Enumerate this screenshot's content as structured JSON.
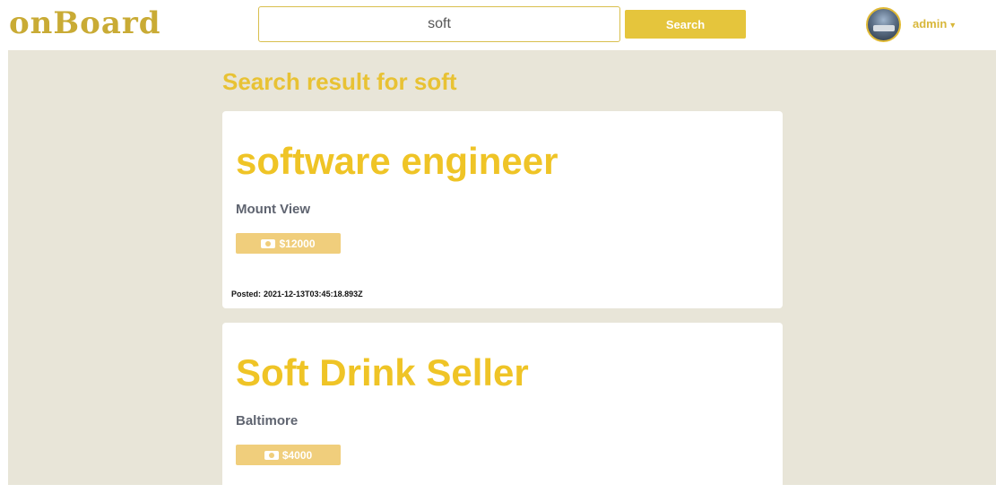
{
  "header": {
    "logo_text": "onBoard",
    "search": {
      "value": "soft",
      "placeholder": ""
    },
    "search_button_label": "Search",
    "user": {
      "name": "admin"
    }
  },
  "results": {
    "heading": "Search result for soft",
    "jobs": [
      {
        "title": "software engineer",
        "location": "Mount View",
        "salary": "$12000",
        "posted_label": "Posted:",
        "posted_date": "2021-12-13T03:45:18.893Z"
      },
      {
        "title": "Soft Drink Seller",
        "location": "Baltimore",
        "salary": "$4000"
      }
    ]
  },
  "colors": {
    "accent": "#e5c53c",
    "page_background": "#e8e5d8",
    "card_background": "#ffffff",
    "badge": "#f0ce7c"
  }
}
